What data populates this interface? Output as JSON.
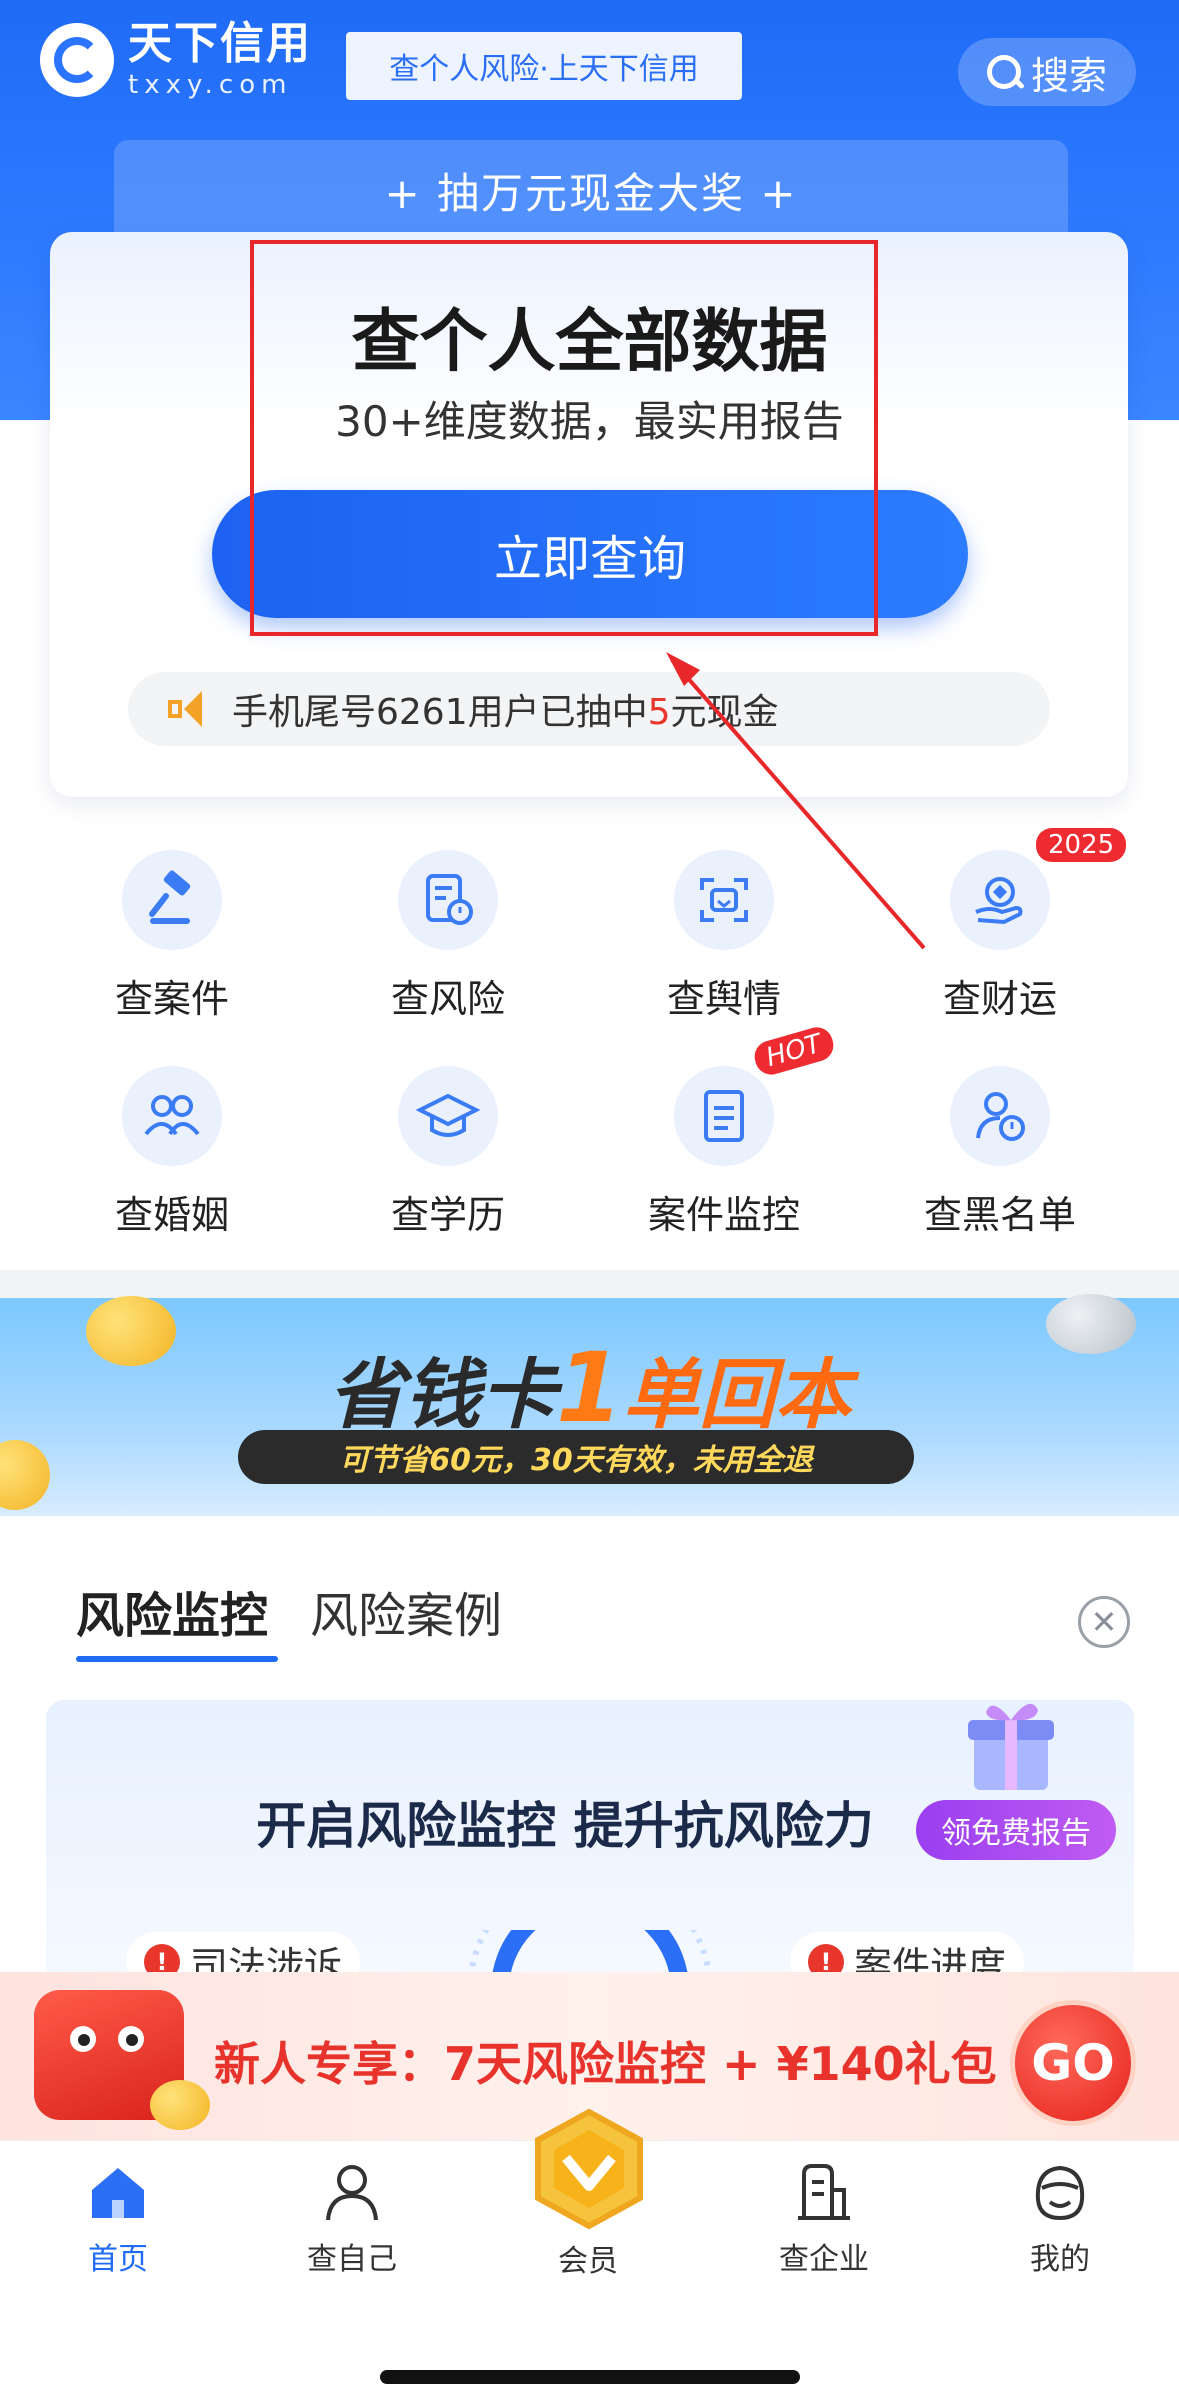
{
  "header": {
    "logo_cn": "天下信用",
    "logo_en": "txxy.com",
    "slogan": "查个人风险·上天下信用",
    "search_label": "搜索"
  },
  "prize_banner": "+ 抽万元现金大奖 +",
  "main_card": {
    "title": "查个人全部数据",
    "subtitle": "30+维度数据，最实用报告",
    "button": "立即查询",
    "ticker_prefix": "手机尾号6261用户已抽中",
    "ticker_highlight": "5",
    "ticker_suffix": "元现金"
  },
  "services": [
    {
      "label": "查案件",
      "icon": "gavel-icon"
    },
    {
      "label": "查风险",
      "icon": "risk-document-icon"
    },
    {
      "label": "查舆情",
      "icon": "face-scan-icon"
    },
    {
      "label": "查财运",
      "icon": "coin-hand-icon",
      "badge": "2025"
    },
    {
      "label": "查婚姻",
      "icon": "couple-icon"
    },
    {
      "label": "查学历",
      "icon": "graduation-cap-icon"
    },
    {
      "label": "案件监控",
      "icon": "case-monitor-icon",
      "badge": "HOT"
    },
    {
      "label": "查黑名单",
      "icon": "blacklist-person-icon"
    }
  ],
  "promo": {
    "title_a": "省钱卡",
    "title_b": "1",
    "title_c": "单回本",
    "pill": "可节省60元，30天有效，未用全退"
  },
  "tabs": [
    {
      "label": "风险监控",
      "active": true
    },
    {
      "label": "风险案例",
      "active": false
    }
  ],
  "monitor": {
    "title": "开启风险监控 提升抗风险力",
    "free_report": "领免费报告",
    "chip_left": "司法涉诉",
    "chip_right": "案件进度"
  },
  "newbie": {
    "text": "新人专享：7天风险监控 + ¥140礼包",
    "go": "GO"
  },
  "bottom_nav": [
    {
      "label": "首页",
      "icon": "home-icon",
      "active": true
    },
    {
      "label": "查自己",
      "icon": "person-icon",
      "active": false
    },
    {
      "label": "会员",
      "icon": "vip-crown-icon",
      "active": false
    },
    {
      "label": "查企业",
      "icon": "building-icon",
      "active": false
    },
    {
      "label": "我的",
      "icon": "smile-face-icon",
      "active": false
    }
  ],
  "colors": {
    "brand_blue": "#1f6bf6",
    "annotation_red": "#e8272b",
    "alert_red": "#e8362c"
  }
}
